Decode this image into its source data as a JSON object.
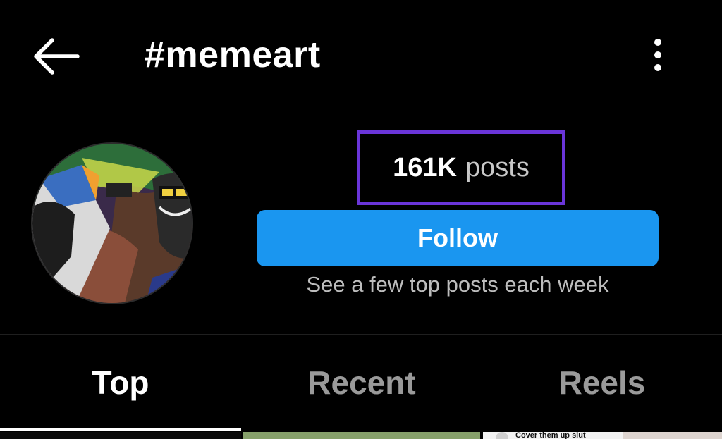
{
  "header": {
    "title": "#memeart",
    "back_icon": "arrow-left-icon",
    "more_icon": "more-vertical-icon"
  },
  "profile": {
    "avatar_alt": "memeart-hashtag-avatar",
    "post_count": "161K",
    "post_label": "posts",
    "follow_label": "Follow",
    "follow_hint": "See a few top posts each week"
  },
  "tabs": [
    {
      "label": "Top",
      "active": true
    },
    {
      "label": "Recent",
      "active": false
    },
    {
      "label": "Reels",
      "active": false
    }
  ],
  "grid": {
    "thumb_caption": "Cover them up slut"
  },
  "colors": {
    "background": "#000000",
    "follow_button": "#1a96f0",
    "highlight_box": "#6a35d9",
    "inactive_tab": "#9a9a9a"
  }
}
